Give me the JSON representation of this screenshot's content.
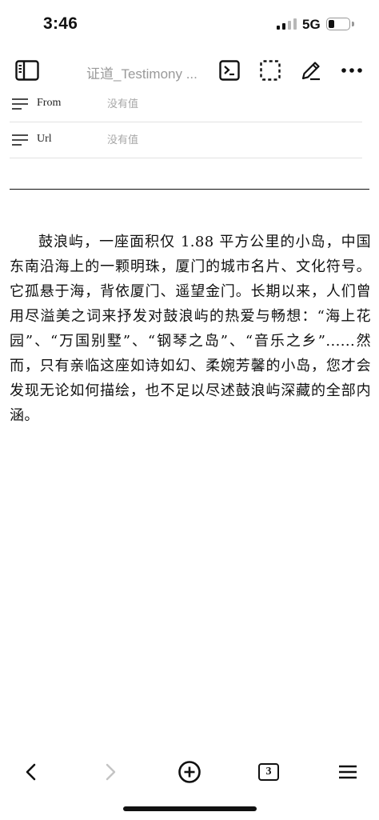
{
  "status_bar": {
    "time": "3:46",
    "network": "5G",
    "signal_bars_active": 2,
    "signal_bars_total": 4,
    "battery_level": 0.3
  },
  "toolbar": {
    "title": "证道_Testimony ...",
    "icons": [
      "sidebar-icon",
      "terminal-icon",
      "dashed-select-icon",
      "pencil-icon",
      "more-icon"
    ]
  },
  "properties": [
    {
      "label": "From",
      "value": "没有值"
    },
    {
      "label": "Url",
      "value": "没有值"
    }
  ],
  "article": {
    "paragraph": "鼓浪屿，一座面积仅 1.88 平方公里的小岛，中国东南沿海上的一颗明珠，厦门的城市名片、文化符号。它孤悬于海，背依厦门、遥望金门。长期以来，人们曾用尽溢美之词来抒发对鼓浪屿的热爱与畅想：“海上花园”、“万国别墅”、“钢琴之岛”、“音乐之乡”......然而，只有亲临这座如诗如幻、柔婉芳馨的小岛，您才会发现无论如何描绘，也不足以尽述鼓浪屿深藏的全部内涵。"
  },
  "bottom_bar": {
    "tab_count": "3",
    "icons": [
      "back-icon",
      "forward-icon",
      "add-icon",
      "tabs-icon",
      "menu-icon"
    ]
  },
  "colors": {
    "text": "#111111",
    "muted": "#9a9a9a",
    "divider": "#e2e2e2",
    "disabled": "#c4c4c4"
  }
}
